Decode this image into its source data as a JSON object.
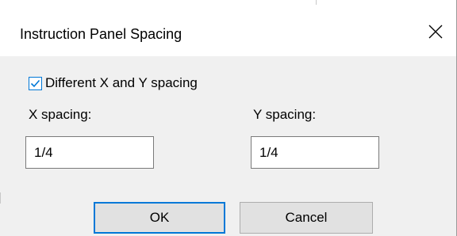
{
  "dialog": {
    "title": "Instruction Panel Spacing",
    "close_icon": "close-icon"
  },
  "options": {
    "different_spacing": {
      "label": "Different X and Y spacing",
      "checked": true
    }
  },
  "fields": {
    "x_spacing": {
      "label": "X spacing:",
      "value": "1/4"
    },
    "y_spacing": {
      "label": "Y spacing:",
      "value": "1/4"
    }
  },
  "buttons": {
    "ok_label": "OK",
    "cancel_label": "Cancel"
  },
  "colors": {
    "accent": "#0078d7",
    "dialog_background": "#f0f0f0",
    "titlebar_background": "#ffffff"
  }
}
